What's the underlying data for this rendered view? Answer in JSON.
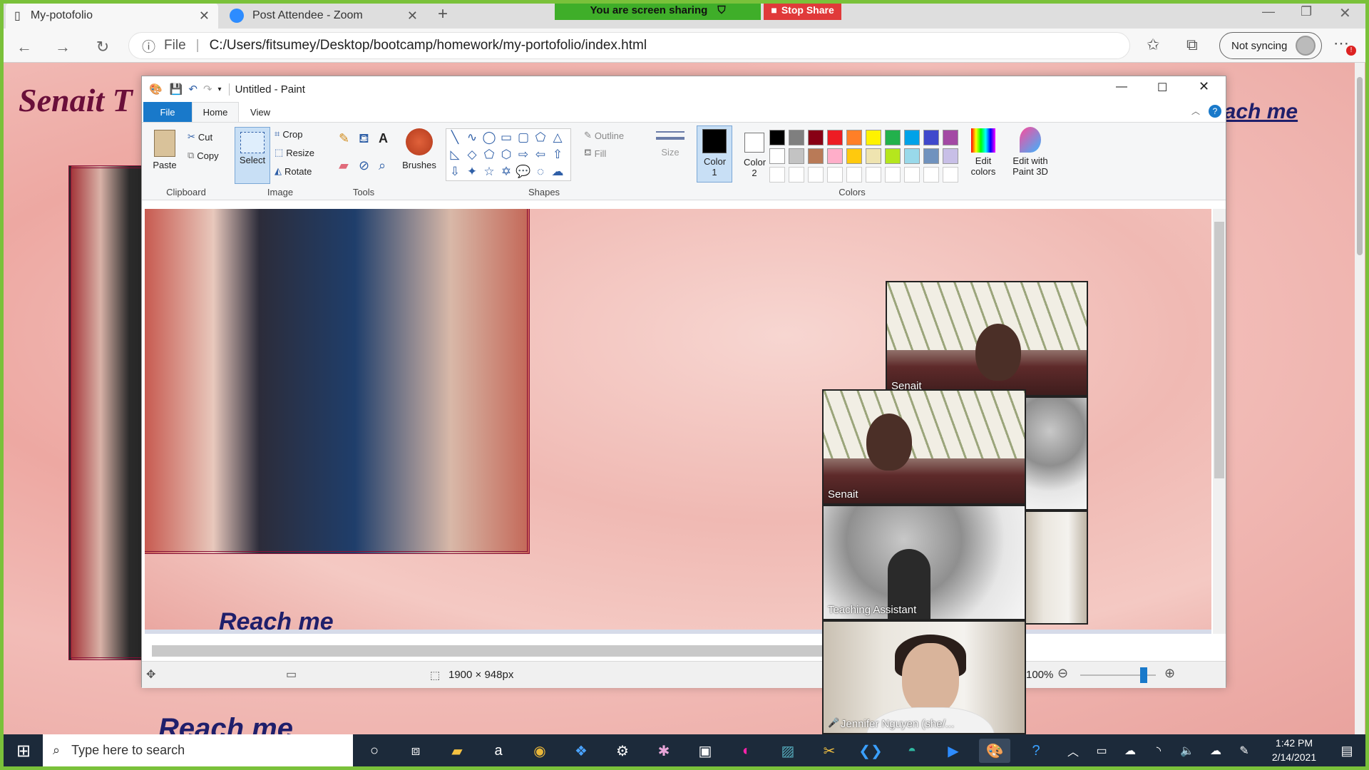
{
  "browser": {
    "tabs": [
      {
        "label": "My-potofolio",
        "active": true
      },
      {
        "label": "Post Attendee - Zoom",
        "active": false
      }
    ],
    "new_tab_icon": "plus-icon",
    "address": {
      "protocol_label": "File",
      "url": "C:/Users/fitsumey/Desktop/bootcamp/homework/my-portofolio/index.html"
    },
    "sync_label": "Not syncing",
    "window_controls": [
      "minimize-icon",
      "restore-icon",
      "close-icon"
    ]
  },
  "screen_share": {
    "message": "You are screen sharing",
    "stop_label": "Stop Share"
  },
  "portfolio": {
    "title": "Senait T",
    "reach_me_nav": "each me",
    "reach_me_heading": "Reach me"
  },
  "paint": {
    "title": "Untitled - Paint",
    "ribbon_tabs": [
      "File",
      "Home",
      "View"
    ],
    "clipboard": {
      "paste": "Paste",
      "cut": "Cut",
      "copy": "Copy",
      "label": "Clipboard"
    },
    "image": {
      "select": "Select",
      "crop": "Crop",
      "resize": "Resize",
      "rotate": "Rotate",
      "label": "Image"
    },
    "tools": {
      "label": "Tools"
    },
    "brushes": "Brushes",
    "shapes": {
      "outline": "Outline",
      "fill": "Fill",
      "label": "Shapes"
    },
    "size": "Size",
    "color1": "Color 1",
    "color2": "Color 2",
    "colors_label": "Colors",
    "edit_colors": "Edit colors",
    "edit_paint3d": "Edit with Paint 3D",
    "palette_row1": [
      "#000000",
      "#7f7f7f",
      "#880015",
      "#ed1c24",
      "#ff7f27",
      "#fff200",
      "#22b14c",
      "#00a2e8",
      "#3f48cc",
      "#a349a4"
    ],
    "palette_row2": [
      "#ffffff",
      "#c3c3c3",
      "#b97a57",
      "#ffaec9",
      "#ffc90e",
      "#efe4b0",
      "#b5e61d",
      "#99d9ea",
      "#7092be",
      "#c8bfe7"
    ],
    "canvas_reach": "Reach me",
    "status": {
      "dimensions": "1900 × 948px",
      "zoom": "100%"
    }
  },
  "zoom_tiles": [
    {
      "name": "Senait",
      "kind": "room"
    },
    {
      "name": "Senait",
      "kind": "room"
    },
    {
      "name": "Teaching Assistant",
      "kind": "snow"
    },
    {
      "name": "Jennifer Nguyen (she/...",
      "kind": "white-room"
    }
  ],
  "taskbar": {
    "search_placeholder": "Type here to search",
    "time": "1:42 PM",
    "date": "2/14/2021"
  },
  "colors": {
    "share_green": "#7ac13a",
    "stop_red": "#e03a3a",
    "portfolio_title": "#6a0f3a",
    "link_blue": "#1f1f6b"
  }
}
